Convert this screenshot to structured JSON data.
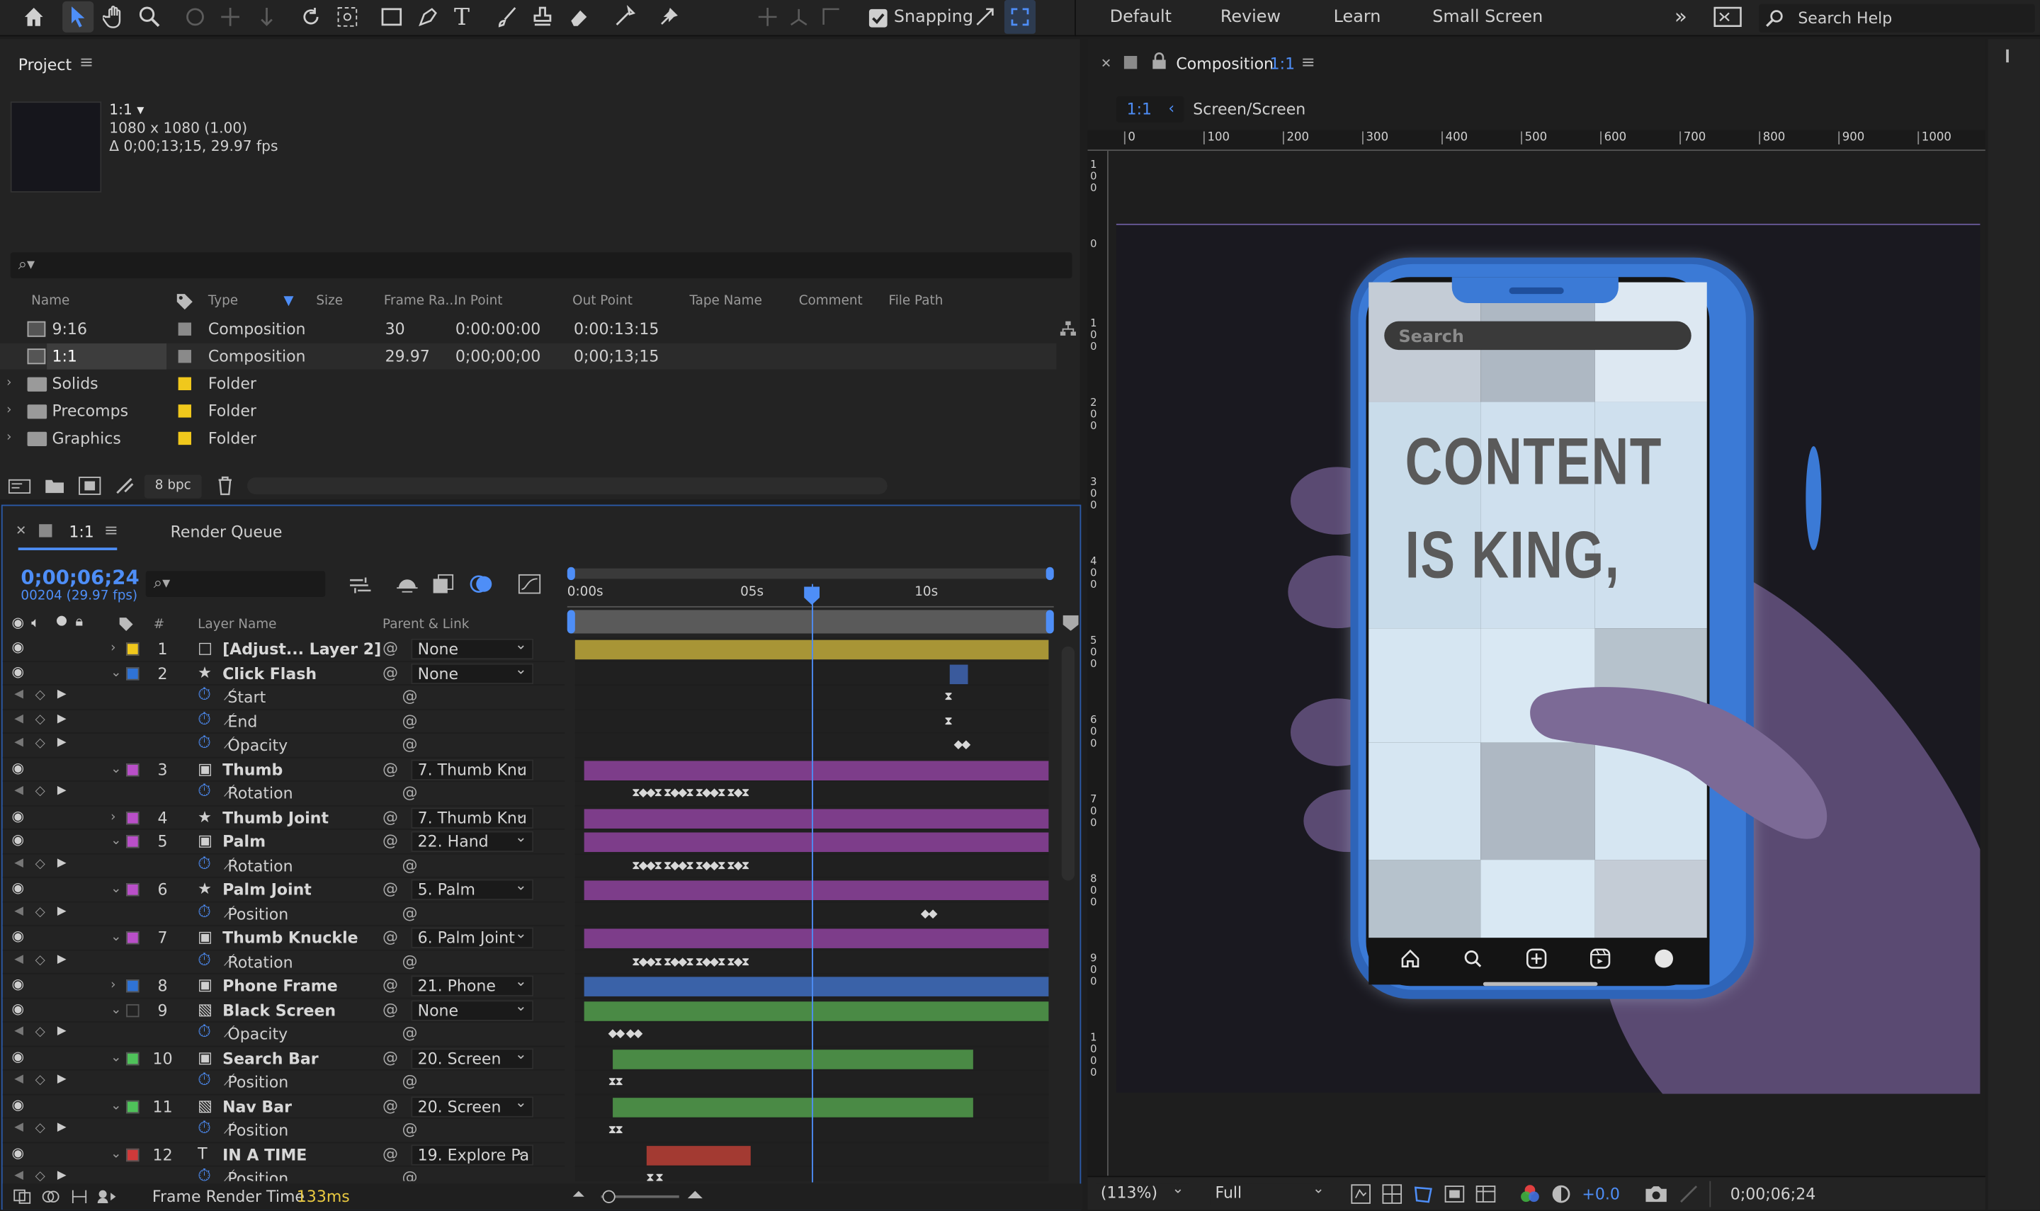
{
  "toolbar": {
    "snapping_label": "Snapping",
    "workspaces": [
      "Default",
      "Review",
      "Learn",
      "Small Screen"
    ],
    "more_glyph": "»",
    "search_help": "Search Help"
  },
  "project": {
    "title": "Project",
    "comp_name": "1:1 ▾",
    "comp_size": "1080 x 1080 (1.00)",
    "comp_duration": "Δ 0;00;13;15, 29.97 fps",
    "search_glyph": "⌕▾",
    "columns": [
      "Name",
      "Type",
      "Size",
      "Frame Ra...",
      "In Point",
      "Out Point",
      "Tape Name",
      "Comment",
      "File Path"
    ],
    "rows": [
      {
        "name": "9:16",
        "type": "Composition",
        "frame_rate": "30",
        "in": "0:00:00:00",
        "out": "0:00:13:15",
        "color": "#8a8a8a"
      },
      {
        "name": "1:1",
        "type": "Composition",
        "frame_rate": "29.97",
        "in": "0;00;00;00",
        "out": "0;00;13;15",
        "color": "#8a8a8a"
      },
      {
        "name": "Solids",
        "type": "Folder",
        "frame_rate": "",
        "in": "",
        "out": "",
        "color": "#f0c81c"
      },
      {
        "name": "Precomps",
        "type": "Folder",
        "frame_rate": "",
        "in": "",
        "out": "",
        "color": "#f0c81c"
      },
      {
        "name": "Graphics",
        "type": "Folder",
        "frame_rate": "",
        "in": "",
        "out": "",
        "color": "#f0c81c"
      }
    ],
    "bpc": "8 bpc"
  },
  "timeline": {
    "tab_name": "1:1",
    "render_queue": "Render Queue",
    "timecode": "0;00;06;24",
    "frame_info": "00204 (29.97 fps)",
    "search_glyph": "⌕▾",
    "col_layer_name": "Layer Name",
    "col_parent": "Parent & Link",
    "col_num": "#",
    "ruler": [
      "0:00s",
      "05s",
      "10s"
    ],
    "playhead_fraction": 0.5,
    "frame_render_label": "Frame Render Time",
    "frame_render_value": "133ms",
    "layers": [
      {
        "kind": "layer",
        "expand": "›",
        "num": "1",
        "icon": "□",
        "name": "[Adjust... Layer 2]",
        "label": "#f0c81c",
        "parent": "None",
        "bar_color": "#a89536",
        "bar": [
          0.0,
          1.0
        ]
      },
      {
        "kind": "layer",
        "expand": "⌄",
        "num": "2",
        "icon": "★",
        "name": "Click Flash",
        "label": "#2f73d6",
        "parent": "None",
        "bar_color": "#3a5a9c",
        "bar": [
          0.79,
          0.83
        ]
      },
      {
        "kind": "prop",
        "name": "Start",
        "keys": "⧗",
        "keys_pos": 0.78
      },
      {
        "kind": "prop",
        "name": "End",
        "keys": "⧗",
        "keys_pos": 0.78
      },
      {
        "kind": "prop",
        "name": "Opacity",
        "keys": "◆◆",
        "keys_pos": 0.8
      },
      {
        "kind": "layer",
        "expand": "⌄",
        "num": "3",
        "icon": "▣",
        "name": "Thumb",
        "label": "#b94fc8",
        "parent": "7. Thumb Knu",
        "bar_color": "#7d3d8a",
        "bar": [
          0.02,
          1.0
        ]
      },
      {
        "kind": "prop",
        "name": "Rotation",
        "keys": "⧗◆◆⧗    ⧗◆◆⧗    ⧗◆◆⧗    ⧗◆⧗",
        "keys_pos": 0.12
      },
      {
        "kind": "layer",
        "expand": "›",
        "num": "4",
        "icon": "★",
        "name": "Thumb Joint",
        "label": "#b94fc8",
        "parent": "7. Thumb Knu",
        "bar_color": "#7d3d8a",
        "bar": [
          0.02,
          1.0
        ]
      },
      {
        "kind": "layer",
        "expand": "⌄",
        "num": "5",
        "icon": "▣",
        "name": "Palm",
        "label": "#b94fc8",
        "parent": "22. Hand",
        "bar_color": "#7d3d8a",
        "bar": [
          0.02,
          1.0
        ]
      },
      {
        "kind": "prop",
        "name": "Rotation",
        "keys": "⧗◆◆⧗    ⧗◆◆⧗    ⧗◆◆⧗    ⧗◆⧗",
        "keys_pos": 0.12
      },
      {
        "kind": "layer",
        "expand": "⌄",
        "num": "6",
        "icon": "★",
        "name": "Palm Joint",
        "label": "#b94fc8",
        "parent": "5. Palm",
        "bar_color": "#7d3d8a",
        "bar": [
          0.02,
          1.0
        ]
      },
      {
        "kind": "prop",
        "name": "Position",
        "keys": "◆◆",
        "keys_pos": 0.73
      },
      {
        "kind": "layer",
        "expand": "⌄",
        "num": "7",
        "icon": "▣",
        "name": "Thumb Knuckle",
        "label": "#b94fc8",
        "parent": "6. Palm Joint",
        "bar_color": "#7d3d8a",
        "bar": [
          0.02,
          1.0
        ]
      },
      {
        "kind": "prop",
        "name": "Rotation",
        "keys": "⧗◆◆⧗    ⧗◆◆⧗    ⧗◆◆⧗    ⧗◆⧗",
        "keys_pos": 0.12
      },
      {
        "kind": "layer",
        "expand": "›",
        "num": "8",
        "icon": "▣",
        "name": "Phone Frame",
        "label": "#2f73d6",
        "parent": "21. Phone",
        "bar_color": "#3a62a8",
        "bar": [
          0.02,
          1.0
        ]
      },
      {
        "kind": "layer",
        "expand": "⌄",
        "num": "9",
        "icon": "▧",
        "name": "Black Screen",
        "label": "#222222",
        "parent": "None",
        "bar_color": "#4a8a45",
        "bar": [
          0.02,
          1.0
        ]
      },
      {
        "kind": "prop",
        "name": "Opacity",
        "keys": "◆◆                                          ◆◆",
        "keys_pos": 0.07
      },
      {
        "kind": "layer",
        "expand": "⌄",
        "num": "10",
        "icon": "▣",
        "name": "Search Bar",
        "label": "#4fc25a",
        "parent": "20. Screen",
        "bar_color": "#4a8a45",
        "bar": [
          0.08,
          0.84
        ]
      },
      {
        "kind": "prop",
        "name": "Position",
        "keys": "⧗⧗",
        "keys_pos": 0.07
      },
      {
        "kind": "layer",
        "expand": "⌄",
        "num": "11",
        "icon": "▧",
        "name": "Nav Bar",
        "label": "#4fc25a",
        "parent": "20. Screen",
        "bar_color": "#4a8a45",
        "bar": [
          0.08,
          0.84
        ]
      },
      {
        "kind": "prop",
        "name": "Position",
        "keys": "⧗⧗",
        "keys_pos": 0.07
      },
      {
        "kind": "layer",
        "expand": "⌄",
        "num": "12",
        "icon": "T",
        "name": "IN A TIME",
        "label": "#d03a3a",
        "parent": "19. Explore Pa",
        "bar_color": "#a33a32",
        "bar": [
          0.15,
          0.37
        ]
      },
      {
        "kind": "prop",
        "name": "Position",
        "keys": "⧗          ⧗",
        "keys_pos": 0.15
      }
    ]
  },
  "composition": {
    "title": "Composition",
    "title_name": "1:1",
    "breadcrumb_active": "1:1",
    "breadcrumb_path": "Screen/Screen",
    "ruler_top": [
      "0",
      "100",
      "200",
      "300",
      "400",
      "500",
      "600",
      "700",
      "800",
      "900",
      "1000"
    ],
    "ruler_left": [
      "1 0 0",
      "0",
      "1 0 0",
      "2 0 0",
      "3 0 0",
      "4 0 0",
      "5 0 0",
      "6 0 0",
      "7 0 0",
      "8 0 0",
      "9 0 0",
      "1 0 0 0"
    ],
    "search_placeholder": "Search",
    "headline_1": "CONTENT",
    "headline_2": "IS KING,",
    "zoom": "(113%)",
    "resolution": "Full",
    "exposure": "+0.0",
    "timecode": "0;00;06;24"
  }
}
